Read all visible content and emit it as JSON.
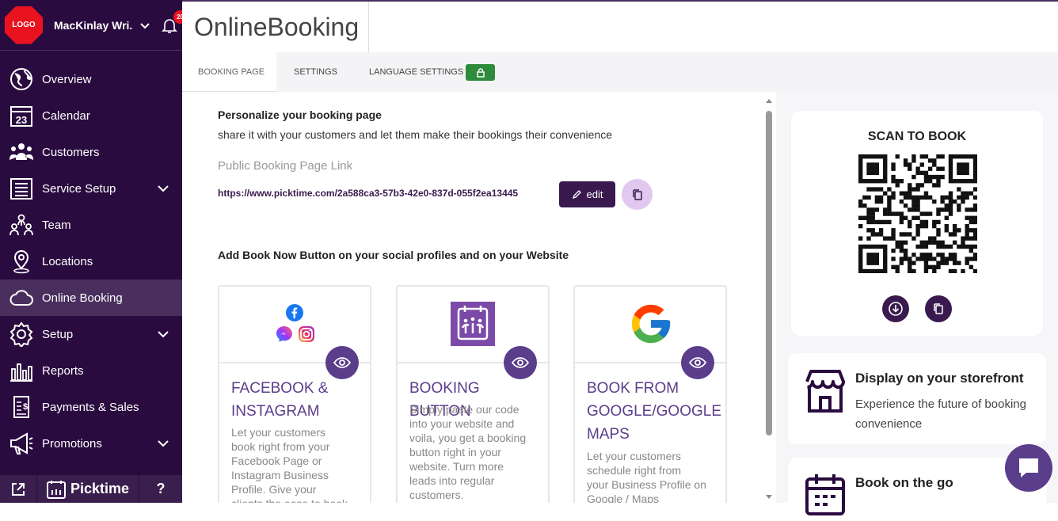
{
  "sidebar": {
    "logo_text": "LOGO",
    "company": "MacKinlay Wri...",
    "notifications": "20",
    "items": [
      {
        "label": "Overview",
        "icon": "globe-icon"
      },
      {
        "label": "Calendar",
        "icon": "calendar-icon",
        "icon_text": "23"
      },
      {
        "label": "Customers",
        "icon": "customers-icon"
      },
      {
        "label": "Service Setup",
        "icon": "list-icon"
      },
      {
        "label": "Team",
        "icon": "team-icon"
      },
      {
        "label": "Locations",
        "icon": "location-icon"
      },
      {
        "label": "Online Booking",
        "icon": "cloud-icon"
      },
      {
        "label": "Setup",
        "icon": "gear-icon"
      },
      {
        "label": "Reports",
        "icon": "bar-chart-icon"
      },
      {
        "label": "Payments & Sales",
        "icon": "invoice-icon"
      },
      {
        "label": "Promotions",
        "icon": "megaphone-icon"
      }
    ],
    "footer": {
      "brand": "Picktime",
      "help": "?"
    }
  },
  "header": {
    "title": "OnlineBooking"
  },
  "tabs": [
    {
      "label": "BOOKING PAGE"
    },
    {
      "label": "SETTINGS"
    },
    {
      "label": "LANGUAGE SETTINGS"
    }
  ],
  "main": {
    "personalize_title": "Personalize your booking page",
    "personalize_sub": "share it with your customers and let them make their bookings their convenience",
    "link_label": "Public Booking Page Link",
    "link_url": "https://www.picktime.com/2a588ca3-57b3-42e0-837d-055f2ea13445",
    "edit_label": "edit",
    "social_title": "Add Book Now Button on your social profiles and on your Website",
    "cards": [
      {
        "title_lines": [
          "FACEBOOK &",
          "INSTAGRAM"
        ],
        "desc_lines": [
          "Let your customers",
          "book right from your",
          "Facebook Page or",
          "Instagram Business",
          "Profile. Give your",
          "clients the ease to book"
        ]
      },
      {
        "title_lines": [
          "BOOKING BUTTON"
        ],
        "desc_lines": [
          "Simply paste our code",
          "into your website and",
          "voila, you get a booking",
          "button right in your",
          "website. Turn more",
          "leads into regular",
          "customers."
        ]
      },
      {
        "title_lines": [
          "BOOK FROM",
          "GOOGLE/GOOGLE",
          "MAPS"
        ],
        "desc_lines": [
          "Let your customers",
          "schedule right from",
          "your Business Profile on",
          "Google / Maps"
        ]
      }
    ]
  },
  "right": {
    "scan_title": "SCAN TO BOOK",
    "storefront_title": "Display on your storefront",
    "storefront_desc_lines": [
      "Experience the future of booking",
      "convenience"
    ],
    "go_title": "Book on the go"
  },
  "colors": {
    "sidebar": "#2a0b3f",
    "accent": "#5a3d8b",
    "edit_btn": "#3a1a4e",
    "lock": "#2e8b3b"
  }
}
